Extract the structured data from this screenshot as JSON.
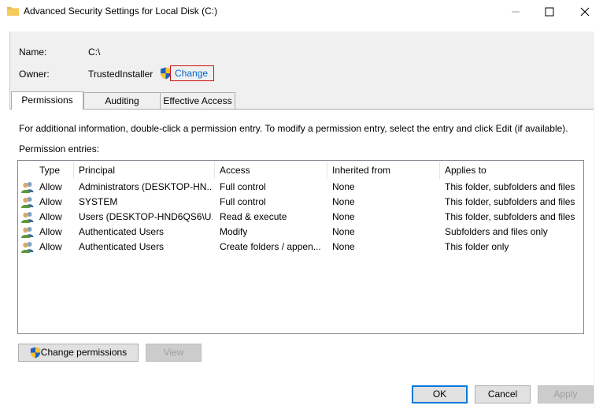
{
  "window": {
    "title": "Advanced Security Settings for Local Disk (C:)"
  },
  "info": {
    "name_label": "Name:",
    "name_value": "C:\\",
    "owner_label": "Owner:",
    "owner_value": "TrustedInstaller",
    "change_link": "Change"
  },
  "tabs": [
    {
      "label": "Permissions",
      "active": true
    },
    {
      "label": "Auditing",
      "active": false
    },
    {
      "label": "Effective Access",
      "active": false
    }
  ],
  "permissions": {
    "instructions": "For additional information, double-click a permission entry. To modify a permission entry, select the entry and click Edit (if available).",
    "entries_label": "Permission entries:",
    "columns": [
      "Type",
      "Principal",
      "Access",
      "Inherited from",
      "Applies to"
    ],
    "rows": [
      {
        "type": "Allow",
        "principal": "Administrators (DESKTOP-HN...",
        "access": "Full control",
        "inherited": "None",
        "applies": "This folder, subfolders and files"
      },
      {
        "type": "Allow",
        "principal": "SYSTEM",
        "access": "Full control",
        "inherited": "None",
        "applies": "This folder, subfolders and files"
      },
      {
        "type": "Allow",
        "principal": "Users (DESKTOP-HND6QS6\\U...",
        "access": "Read & execute",
        "inherited": "None",
        "applies": "This folder, subfolders and files"
      },
      {
        "type": "Allow",
        "principal": "Authenticated Users",
        "access": "Modify",
        "inherited": "None",
        "applies": "Subfolders and files only"
      },
      {
        "type": "Allow",
        "principal": "Authenticated Users",
        "access": "Create folders / appen...",
        "inherited": "None",
        "applies": "This folder only"
      }
    ],
    "change_permissions_button": "Change permissions",
    "view_button": "View"
  },
  "footer": {
    "ok": "OK",
    "cancel": "Cancel",
    "apply": "Apply"
  },
  "colors": {
    "link": "#0066cc",
    "highlight_box": "#d01010",
    "default_button_border": "#0078d7"
  }
}
